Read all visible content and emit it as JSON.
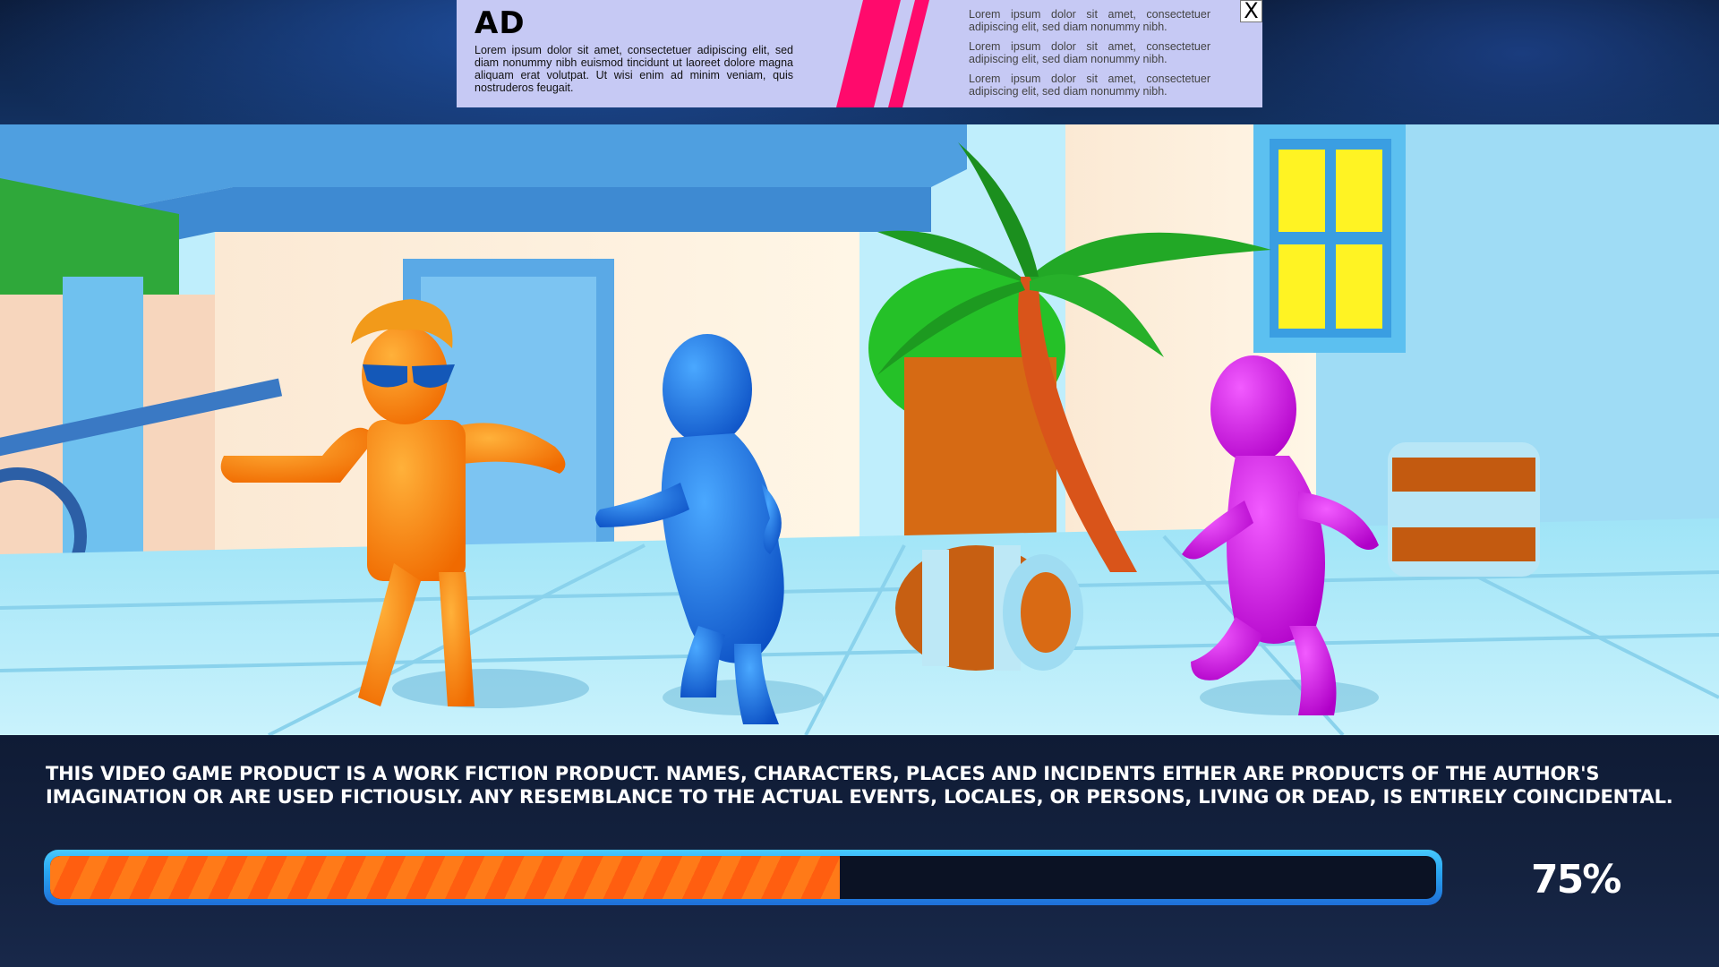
{
  "ad": {
    "title": "AD",
    "body": "Lorem ipsum dolor sit amet, consectetuer adipiscing elit, sed diam nonummy nibh euismod tincidunt ut laoreet dolore magna aliquam erat volutpat. Ut wisi enim ad minim veniam, quis nostruderos feugait.",
    "side_texts": [
      "Lorem ipsum dolor sit amet, consectetuer adipiscing elit, sed diam nonummy nibh.",
      "Lorem ipsum dolor sit amet, consectetuer adipiscing elit, sed diam nonummy nibh.",
      "Lorem ipsum dolor sit amet, consectetuer adipiscing elit, sed diam nonummy nibh."
    ],
    "close_label": "X",
    "accent_color": "#ff0a6c",
    "background_color": "#c6c9f4"
  },
  "disclaimer": "THIS VIDEO GAME PRODUCT IS A WORK FICTION PRODUCT. NAMES, CHARACTERS, PLACES AND INCIDENTS EITHER ARE PRODUCTS OF THE AUTHOR'S IMAGINATION OR ARE USED FICTIOUSLY. ANY RESEMBLANCE TO THE ACTUAL EVENTS, LOCALES, OR PERSONS, LIVING OR DEAD, IS ENTIRELY COINCIDENTAL.",
  "loading": {
    "progress": 0.57,
    "percent_label": "75%",
    "fill_color": "#ff7a18",
    "track_color": "#2aa6f0"
  },
  "scene": {
    "characters": [
      {
        "name": "orange-character",
        "color": "#ff8a12"
      },
      {
        "name": "blue-character",
        "color": "#1a78e6"
      },
      {
        "name": "magenta-character",
        "color": "#d81ae8"
      }
    ],
    "props": [
      "palm-tree",
      "barrel",
      "window",
      "cart-wheel"
    ]
  }
}
